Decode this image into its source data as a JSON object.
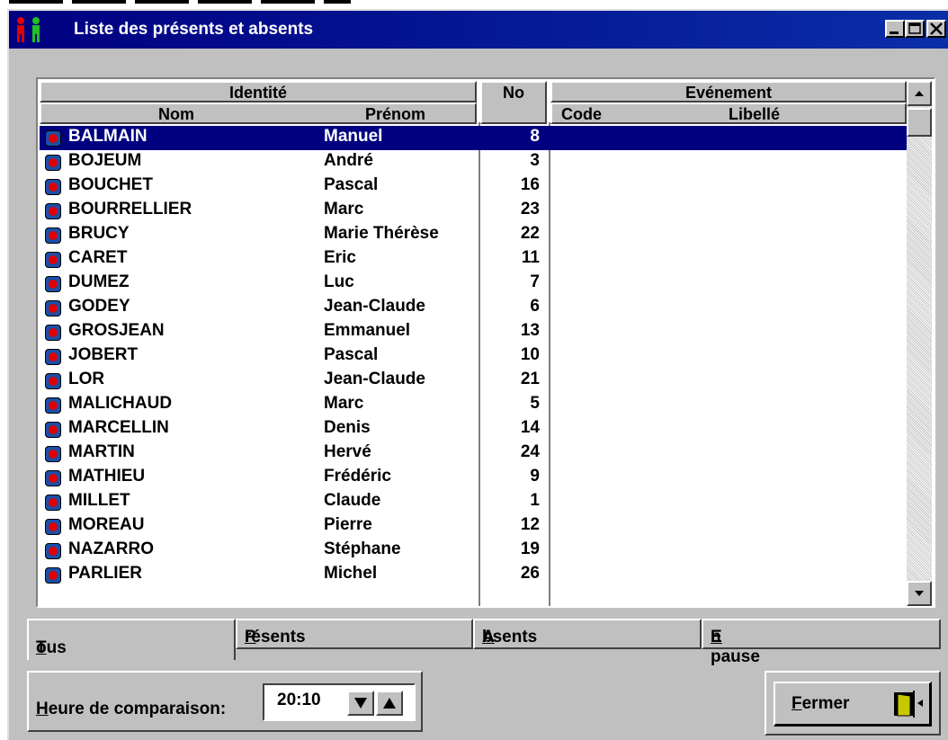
{
  "window": {
    "title": "Liste des présents et absents",
    "controls": [
      "minimize-icon",
      "maximize-icon",
      "close-icon"
    ]
  },
  "table": {
    "headers": {
      "identite": "Identité",
      "nom": "Nom",
      "prenom": "Prénom",
      "no": "No",
      "evenement": "Evénement",
      "code": "Code",
      "libelle": "Libellé"
    },
    "selected_index": 0,
    "rows": [
      {
        "nom": "BALMAIN",
        "prenom": "Manuel",
        "no": "8"
      },
      {
        "nom": "BOJEUM",
        "prenom": "André",
        "no": "3"
      },
      {
        "nom": "BOUCHET",
        "prenom": "Pascal",
        "no": "16"
      },
      {
        "nom": "BOURRELLIER",
        "prenom": "Marc",
        "no": "23"
      },
      {
        "nom": "BRUCY",
        "prenom": "Marie Thérèse",
        "no": "22"
      },
      {
        "nom": "CARET",
        "prenom": "Eric",
        "no": "11"
      },
      {
        "nom": "DUMEZ",
        "prenom": "Luc",
        "no": "7"
      },
      {
        "nom": "GODEY",
        "prenom": "Jean-Claude",
        "no": "6"
      },
      {
        "nom": "GROSJEAN",
        "prenom": "Emmanuel",
        "no": "13"
      },
      {
        "nom": "JOBERT",
        "prenom": "Pascal",
        "no": "10"
      },
      {
        "nom": "LOR",
        "prenom": "Jean-Claude",
        "no": "21"
      },
      {
        "nom": "MALICHAUD",
        "prenom": "Marc",
        "no": "5"
      },
      {
        "nom": "MARCELLIN",
        "prenom": "Denis",
        "no": "14"
      },
      {
        "nom": "MARTIN",
        "prenom": "Hervé",
        "no": "24"
      },
      {
        "nom": "MATHIEU",
        "prenom": "Frédéric",
        "no": "9"
      },
      {
        "nom": "MILLET",
        "prenom": "Claude",
        "no": "1"
      },
      {
        "nom": "MOREAU",
        "prenom": "Pierre",
        "no": "12"
      },
      {
        "nom": "NAZARRO",
        "prenom": "Stéphane",
        "no": "19"
      },
      {
        "nom": "PARLIER",
        "prenom": "Michel",
        "no": "26"
      }
    ]
  },
  "tabs": {
    "tous": {
      "first": "T",
      "rest": "ous"
    },
    "presents": {
      "first": "P",
      "rest": "résents"
    },
    "absents": {
      "first": "A",
      "rest": "bsents"
    },
    "en_pause": {
      "first": "E",
      "rest": "n pause"
    }
  },
  "comparison": {
    "label_first": "H",
    "label_rest": "eure de comparaison:",
    "time": "20:10"
  },
  "close_button": {
    "first": "F",
    "rest": "ermer"
  },
  "colors": {
    "title_bar": "#000080",
    "selection": "#000080",
    "face": "#c0c0c0",
    "status_dot": "#e00000"
  }
}
